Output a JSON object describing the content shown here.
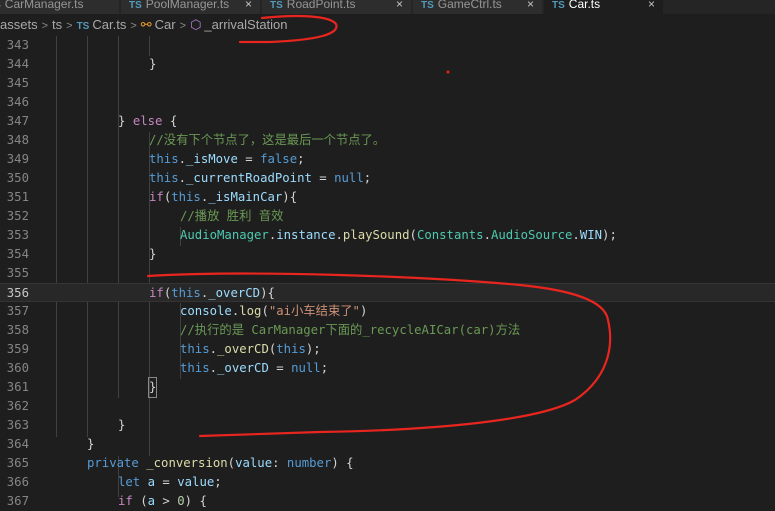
{
  "tabs": [
    {
      "icon": "TS",
      "label": "CarManager.ts"
    },
    {
      "icon": "TS",
      "label": "PoolManager.ts"
    },
    {
      "icon": "TS",
      "label": "RoadPoint.ts"
    },
    {
      "icon": "TS",
      "label": "GameCtrl.ts"
    },
    {
      "icon": "TS",
      "label": "Car.ts"
    }
  ],
  "breadcrumb": {
    "segments": [
      "assets",
      "ts",
      "Car.ts",
      "Car",
      "_arrivalStation"
    ],
    "file_icon": "TS"
  },
  "code": {
    "lines": [
      {
        "n": "343",
        "text": ""
      },
      {
        "n": "344",
        "text": "}"
      },
      {
        "n": "345",
        "text": ""
      },
      {
        "n": "346",
        "text": ""
      },
      {
        "n": "347",
        "text": "} else {"
      },
      {
        "n": "348",
        "text": "//没有下个节点了，这是最后一个节点了。"
      },
      {
        "n": "349",
        "text": "this._isMove = false;"
      },
      {
        "n": "350",
        "text": "this._currentRoadPoint = null;"
      },
      {
        "n": "351",
        "text": "if(this._isMainCar){"
      },
      {
        "n": "352",
        "text": "//播放 胜利 音效"
      },
      {
        "n": "353",
        "text": "AudioManager.instance.playSound(Constants.AudioSource.WIN);"
      },
      {
        "n": "354",
        "text": "}"
      },
      {
        "n": "355",
        "text": ""
      },
      {
        "n": "356",
        "text": "if(this._overCD){"
      },
      {
        "n": "357",
        "text": "console.log(\"ai小车结束了\")"
      },
      {
        "n": "358",
        "text": "//执行的是 CarManager下面的_recycleAICar(car)方法"
      },
      {
        "n": "359",
        "text": "this._overCD(this);"
      },
      {
        "n": "360",
        "text": "this._overCD = null;"
      },
      {
        "n": "361",
        "text": "}"
      },
      {
        "n": "362",
        "text": ""
      },
      {
        "n": "363",
        "text": "}"
      },
      {
        "n": "364",
        "text": "}"
      },
      {
        "n": "365",
        "text": "private _conversion(value: number) {"
      },
      {
        "n": "366",
        "text": "let a = value;"
      },
      {
        "n": "367",
        "text": "if (a > 0) {"
      }
    ]
  },
  "colors": {
    "background": "#1e1e1e",
    "keyword": "#569cd6",
    "control": "#c586c0",
    "comment": "#6a9955",
    "function": "#dcdcaa",
    "variable": "#9cdcfe",
    "class": "#4ec9b0",
    "string": "#ce9178",
    "annotation": "#e8261f"
  }
}
